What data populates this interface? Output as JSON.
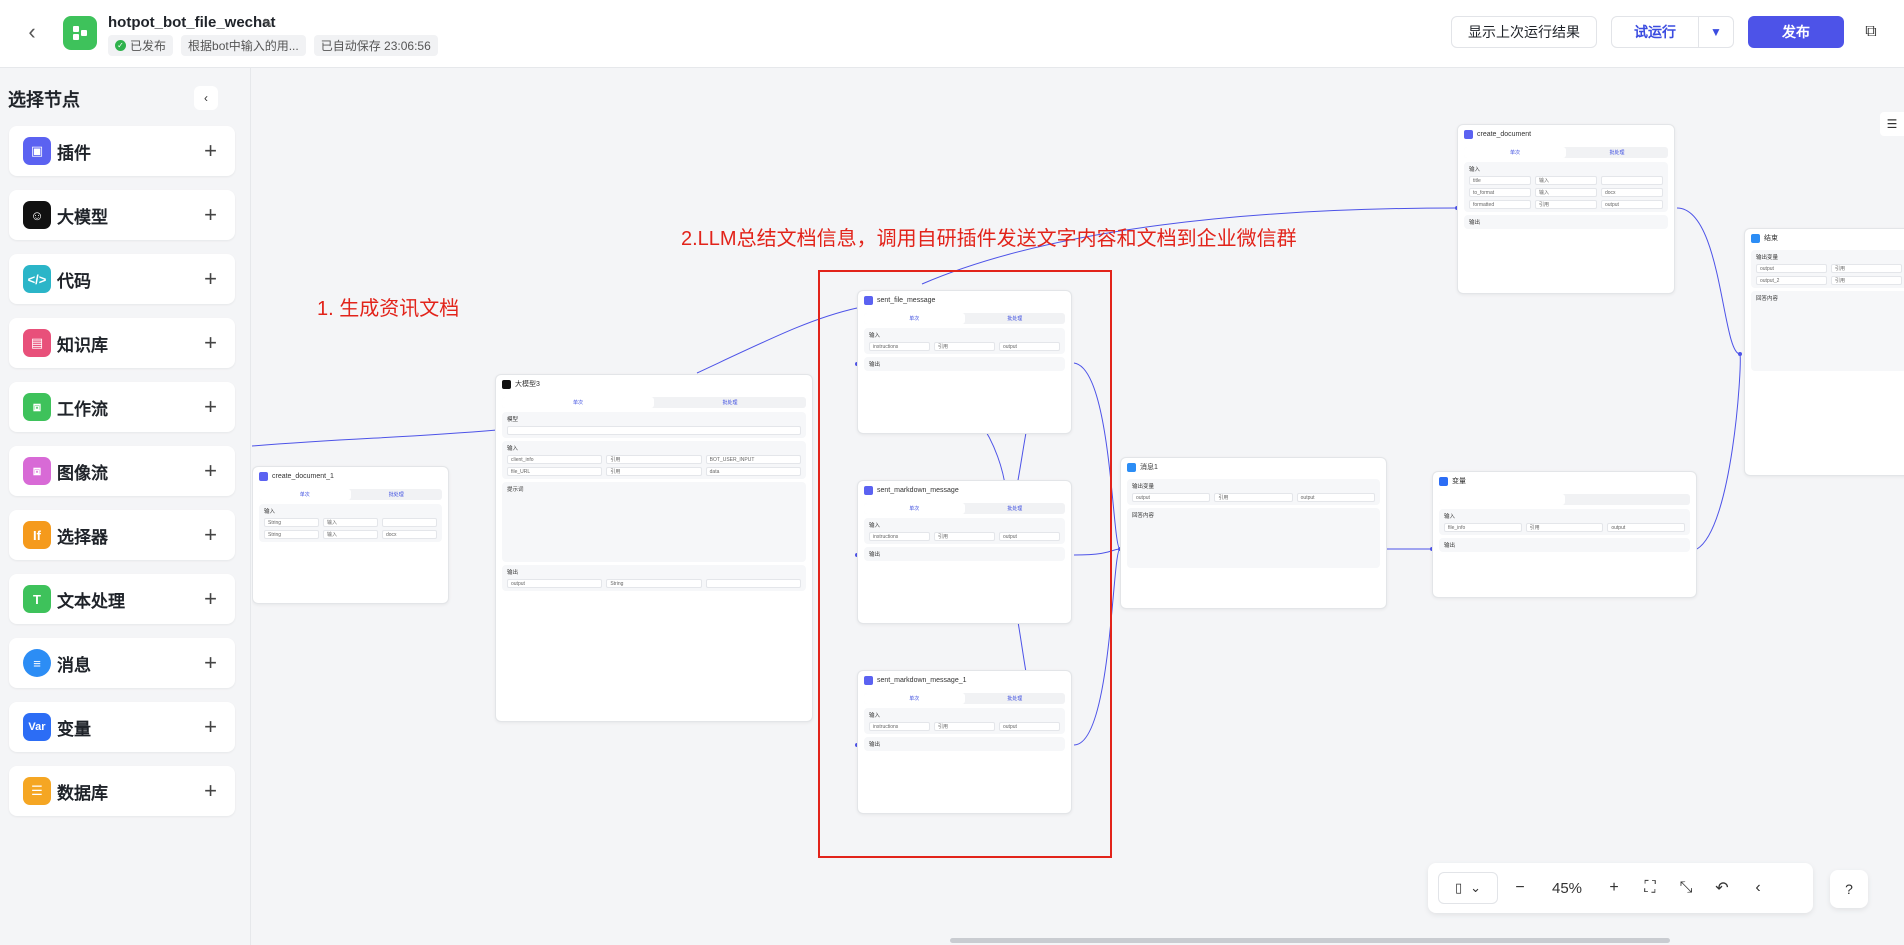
{
  "header": {
    "title": "hotpot_bot_file_wechat",
    "status_published": "已发布",
    "description_tag": "根据bot中输入的用...",
    "autosave": "已自动保存 23:06:56",
    "show_last_run": "显示上次运行结果",
    "trial_run": "试运行",
    "publish": "发布"
  },
  "sidebar": {
    "title": "选择节点",
    "items": [
      {
        "label": "插件",
        "icon": "cube-icon",
        "color": "#5b62f1"
      },
      {
        "label": "大模型",
        "icon": "llm-icon",
        "color": "#111111"
      },
      {
        "label": "代码",
        "icon": "code-icon",
        "color": "#2bb5c8"
      },
      {
        "label": "知识库",
        "icon": "knowledge-icon",
        "color": "#e8507a"
      },
      {
        "label": "工作流",
        "icon": "workflow-icon",
        "color": "#3ec25b"
      },
      {
        "label": "图像流",
        "icon": "imageflow-icon",
        "color": "#d86ad6"
      },
      {
        "label": "选择器",
        "icon": "selector-icon",
        "color": "#f59a1c"
      },
      {
        "label": "文本处理",
        "icon": "text-icon",
        "color": "#3ec25b"
      },
      {
        "label": "消息",
        "icon": "message-icon",
        "color": "#2c8df5"
      },
      {
        "label": "变量",
        "icon": "variable-icon",
        "color": "#2c6df5",
        "glyph": "Var"
      },
      {
        "label": "数据库",
        "icon": "database-icon",
        "color": "#f5a623"
      }
    ]
  },
  "annotations": {
    "step1": "1. 生成资讯文档",
    "step2": "2.LLM总结文档信息，调用自研插件发送文字内容和文档到企业微信群"
  },
  "nodes": {
    "create_document_1": {
      "title": "create_document_1"
    },
    "llm": {
      "title": "大模型3"
    },
    "sent_file_message": {
      "title": "sent_file_message"
    },
    "sent_markdown_message": {
      "title": "sent_markdown_message"
    },
    "sent_markdown_message_1": {
      "title": "sent_markdown_message_1"
    },
    "create_document": {
      "title": "create_document"
    },
    "message": {
      "title": "消息1"
    },
    "variable": {
      "title": "变量"
    },
    "end": {
      "title": "结束"
    }
  },
  "toolbar": {
    "zoom": "45%"
  }
}
